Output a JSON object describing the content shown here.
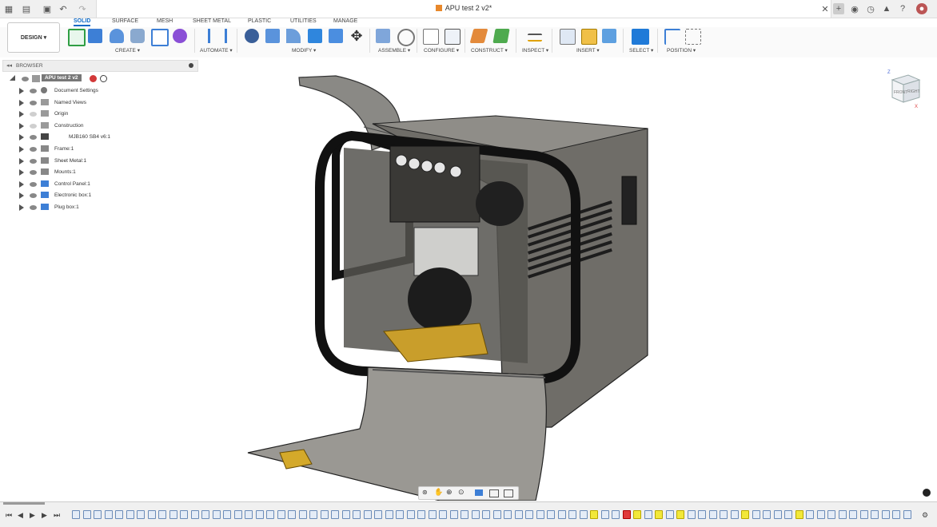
{
  "window": {
    "doc_title": "APU test 2 v2*"
  },
  "ribbon": {
    "tabs": [
      "SOLID",
      "SURFACE",
      "MESH",
      "SHEET METAL",
      "PLASTIC",
      "UTILITIES",
      "MANAGE"
    ],
    "active_tab": "SOLID",
    "workspace": "DESIGN ▾",
    "groups": [
      "CREATE ▾",
      "AUTOMATE ▾",
      "MODIFY ▾",
      "ASSEMBLE ▾",
      "CONFIGURE ▾",
      "CONSTRUCT ▾",
      "INSPECT ▾",
      "INSERT ▾",
      "SELECT ▾",
      "POSITION ▾"
    ]
  },
  "browser": {
    "title": "BROWSER",
    "root": "APU test 2 v2",
    "items": [
      {
        "label": "Document Settings",
        "icon": "gear-icon"
      },
      {
        "label": "Named Views",
        "icon": "folder-icon"
      },
      {
        "label": "Origin",
        "icon": "folder-icon"
      },
      {
        "label": "Construction",
        "icon": "folder-icon"
      },
      {
        "label": "MJB160 SB4 v6:1",
        "icon": "link-icon"
      },
      {
        "label": "Frame:1",
        "icon": "component-icon"
      },
      {
        "label": "Sheet Metal:1",
        "icon": "component-icon"
      },
      {
        "label": "Mounts:1",
        "icon": "component-icon"
      },
      {
        "label": "Control Panel:1",
        "icon": "sheet-metal-component-icon"
      },
      {
        "label": "Electronic box:1",
        "icon": "sheet-metal-component-icon"
      },
      {
        "label": "Plug box:1",
        "icon": "sheet-metal-component-icon"
      }
    ]
  },
  "viewcube": {
    "front": "FRONT",
    "right": "RIGHT",
    "top": "Z",
    "axis_x": "X"
  },
  "colors": {
    "accent": "#0b69c7",
    "panel": "#f0f0f0",
    "model_metal": "#6d6b66",
    "model_yellow": "#d2a82a"
  }
}
